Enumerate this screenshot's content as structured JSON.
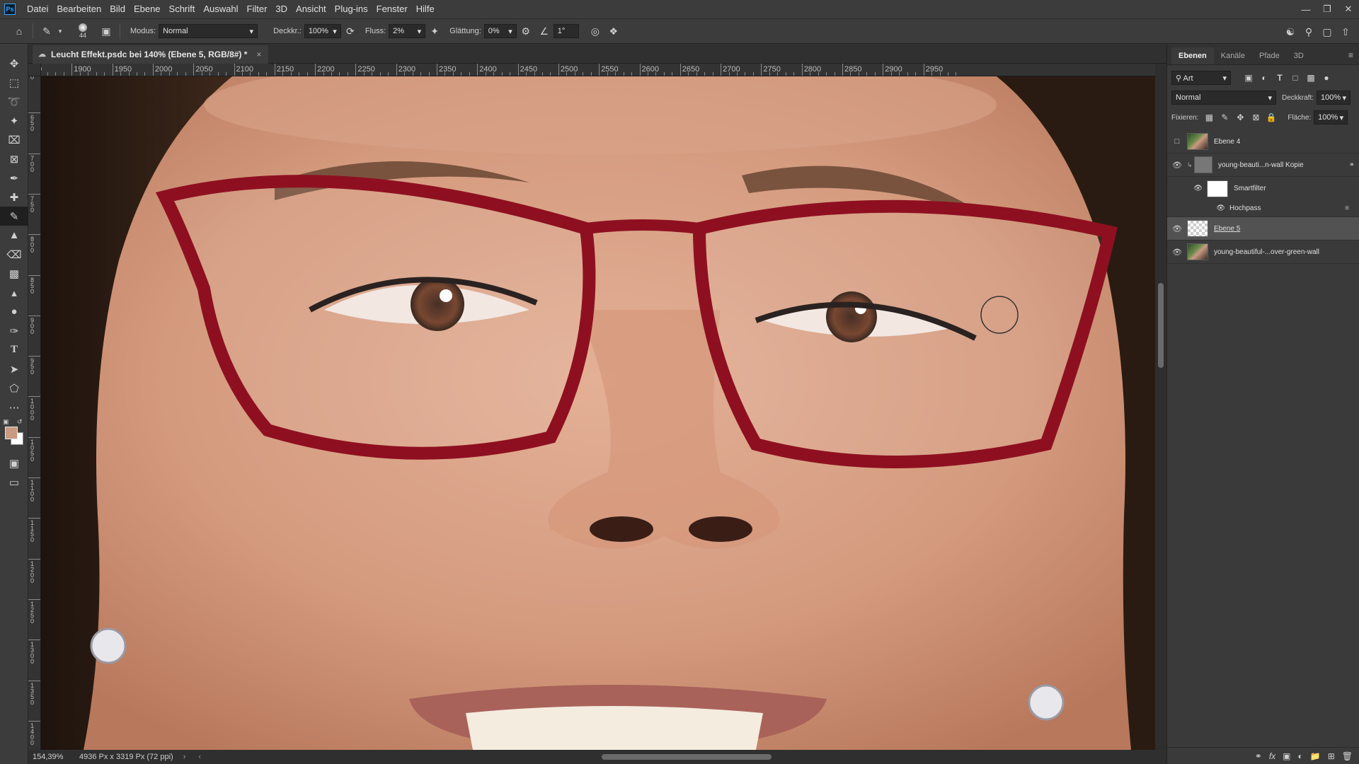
{
  "app": {
    "logo": "Ps"
  },
  "menu": [
    "Datei",
    "Bearbeiten",
    "Bild",
    "Ebene",
    "Schrift",
    "Auswahl",
    "Filter",
    "3D",
    "Ansicht",
    "Plug-ins",
    "Fenster",
    "Hilfe"
  ],
  "options": {
    "brush_size": "44",
    "modus_label": "Modus:",
    "modus_value": "Normal",
    "deckkraft_label": "Deckkr.:",
    "deckkraft_value": "100%",
    "fluss_label": "Fluss:",
    "fluss_value": "2%",
    "glaettung_label": "Glättung:",
    "glaettung_value": "0%",
    "angle_value": "1°"
  },
  "document": {
    "tab_title": "Leucht Effekt.psdc bei 140% (Ebene 5, RGB/8#) *",
    "ruler_labels": [
      "50",
      "1900",
      "1950",
      "2000",
      "2050",
      "2100",
      "2150",
      "2200",
      "2250",
      "2300",
      "2350",
      "2400",
      "2450",
      "2500",
      "2550",
      "2600",
      "2650",
      "2700",
      "2750",
      "2800",
      "2850",
      "2900",
      "2950"
    ],
    "vruler_labels": [
      "0",
      "6 5 0",
      "7 0 0",
      "7 5 0",
      "8 0 0",
      "8 5 0",
      "9 0 0",
      "9 5 0",
      "1 0 0 0",
      "1 0 5 0",
      "1 1 0 0",
      "1 1 5 0",
      "1 2 0 0",
      "1 2 5 0",
      "1 3 0 0",
      "1 3 5 0",
      "1 4 0 0"
    ]
  },
  "status": {
    "zoom": "154,39%",
    "doc_size": "4936 Px x 3319 Px (72 ppi)"
  },
  "layers_panel": {
    "tabs": [
      "Ebenen",
      "Kanäle",
      "Pfade",
      "3D"
    ],
    "active_tab": "Ebenen",
    "filter_label": "Art",
    "blend_mode": "Normal",
    "opacity_label": "Deckkraft:",
    "opacity_value": "100%",
    "lock_label": "Fixieren:",
    "fill_label": "Fläche:",
    "fill_value": "100%",
    "layers": [
      {
        "name": "Ebene 4",
        "visible": false,
        "selected": false
      },
      {
        "name": "young-beauti...n-wall Kopie",
        "visible": true,
        "selected": false
      },
      {
        "name": "Smartfilter",
        "visible": true,
        "selected": false
      },
      {
        "name": "Hochpass",
        "visible": true,
        "selected": false
      },
      {
        "name": "Ebene 5",
        "visible": true,
        "selected": true
      },
      {
        "name": "young-beautiful-...over-green-wall",
        "visible": true,
        "selected": false
      }
    ]
  },
  "colors": {
    "foreground": "#c89a82",
    "background": "#ffffff",
    "accent": "#31a8ff"
  },
  "icons": {
    "tools": [
      "move-icon",
      "marquee-icon",
      "lasso-icon",
      "magic-wand-icon",
      "crop-icon",
      "frame-icon",
      "eyedropper-icon",
      "healing-brush-icon",
      "brush-icon",
      "stamp-icon",
      "eraser-icon",
      "gradient-icon",
      "sharpen-icon",
      "dodge-icon",
      "pen-icon",
      "type-icon",
      "path-selection-icon",
      "shape-icon",
      "more-tools-icon"
    ]
  }
}
